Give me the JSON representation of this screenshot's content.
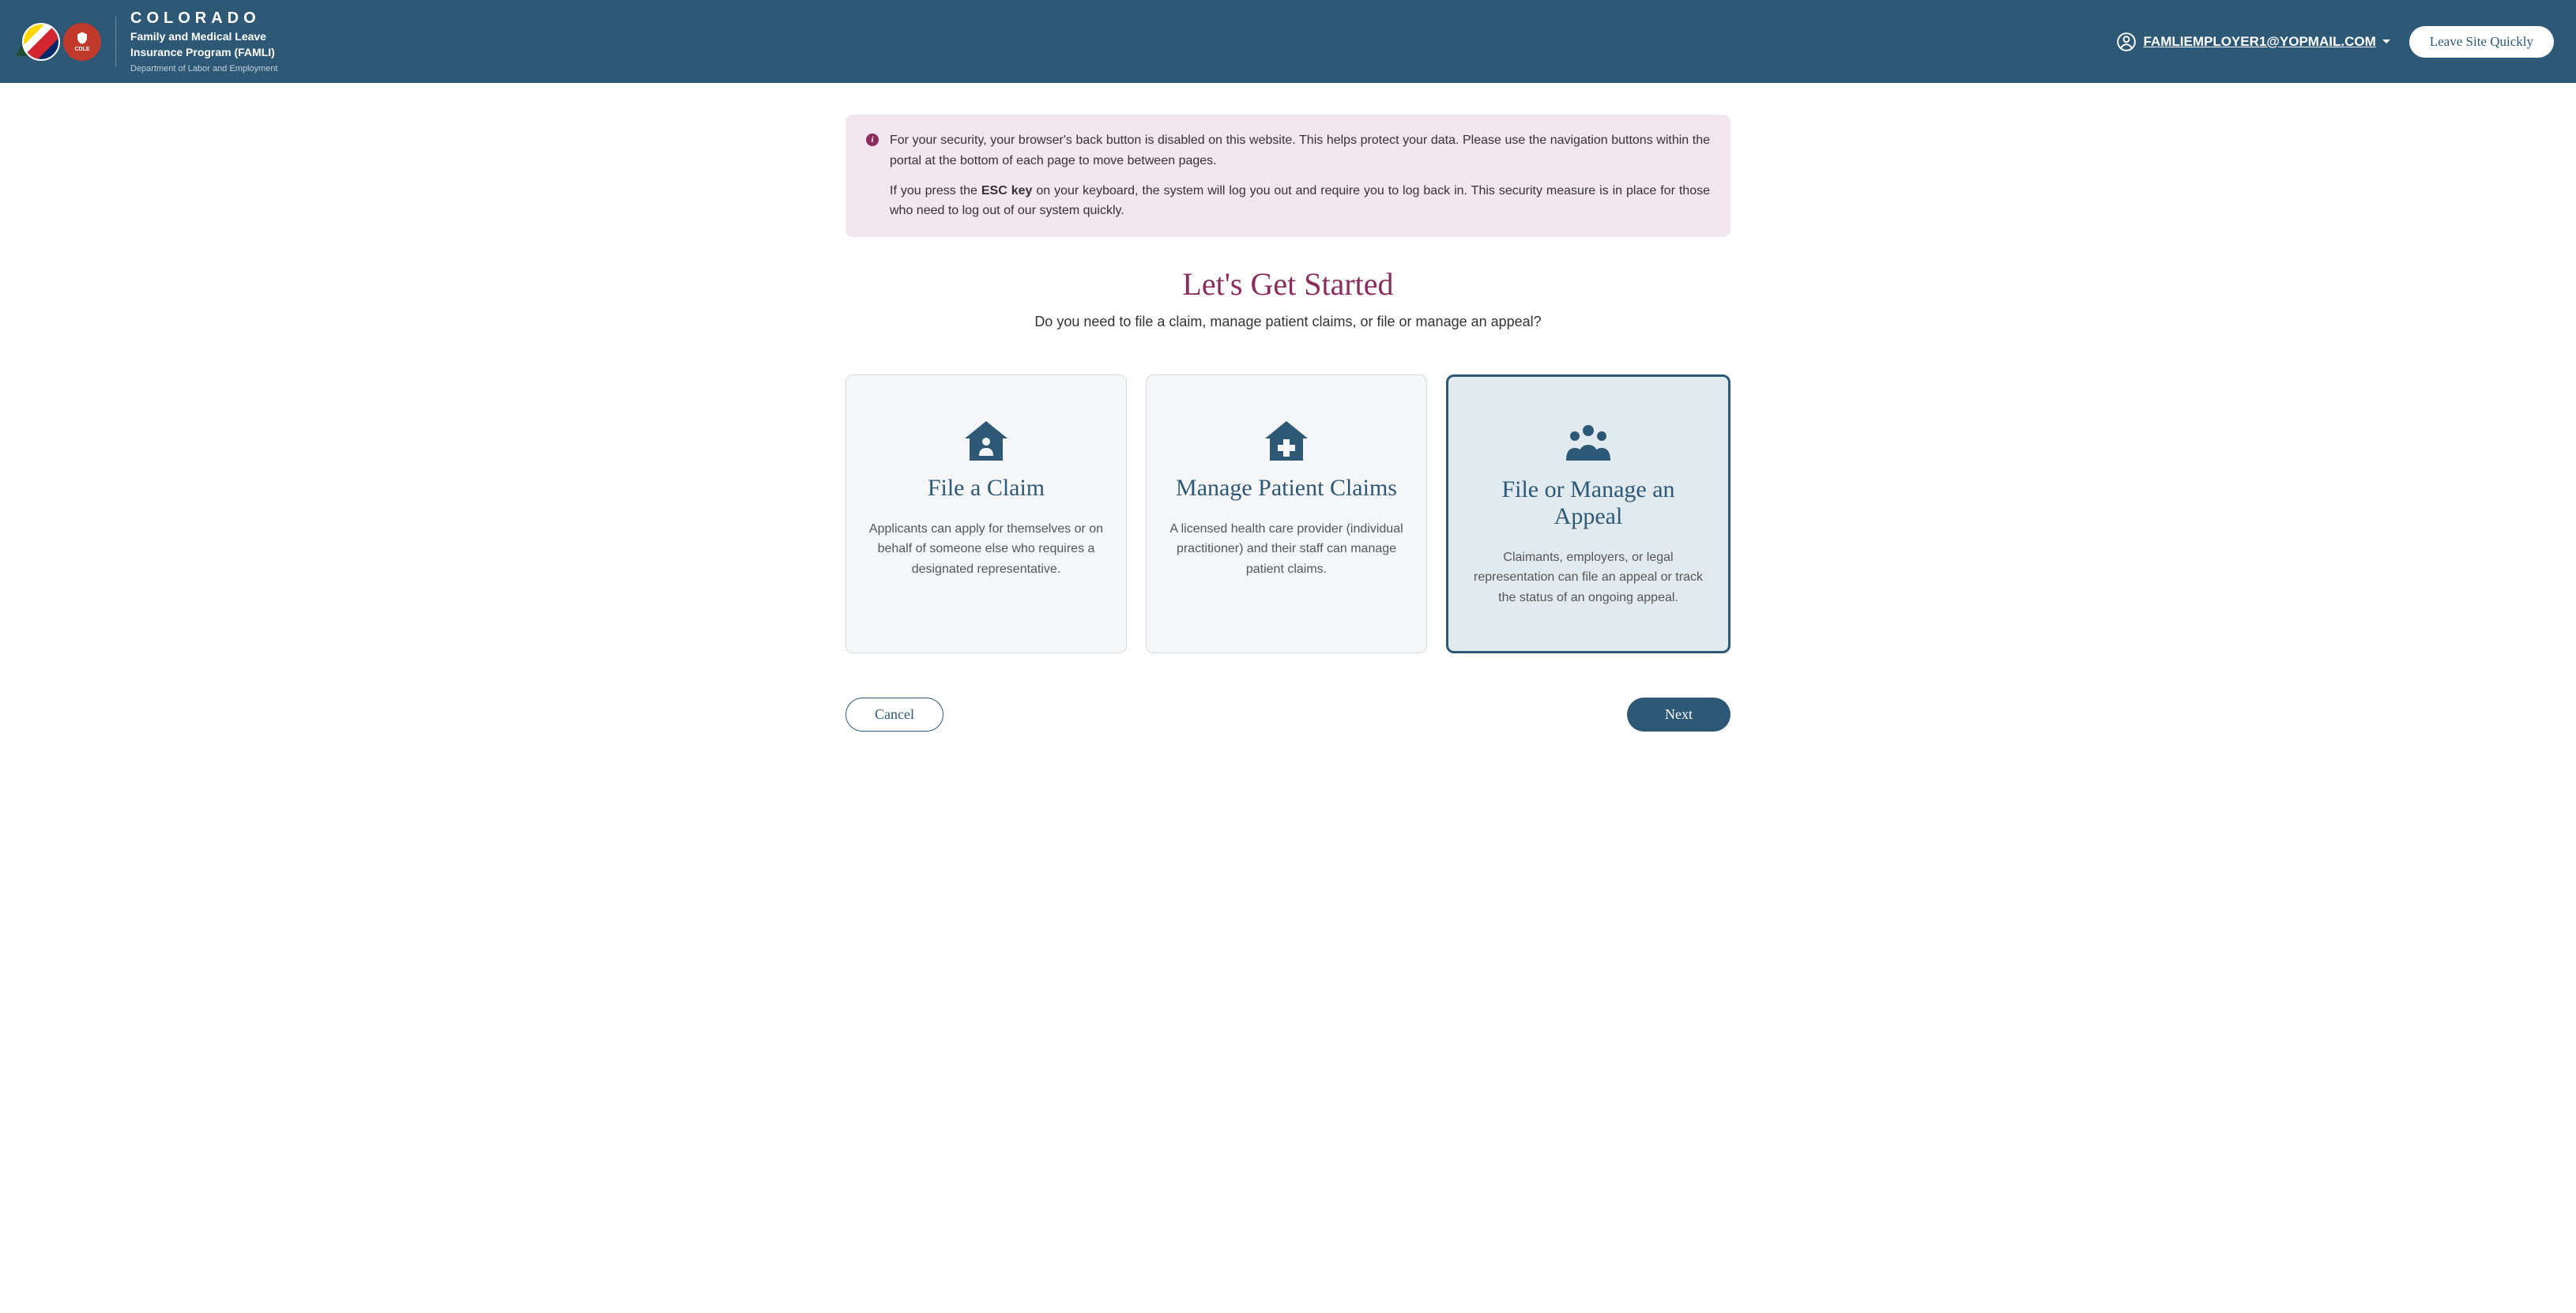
{
  "header": {
    "title_main": "COLORADO",
    "title_sub_line1": "Family and Medical Leave",
    "title_sub_line2": "Insurance Program (FAMLI)",
    "title_dept": "Department of Labor and Employment",
    "logo_cdle_text": "CDLE",
    "user_email": "FAMLIEMPLOYER1@YOPMAIL.COM",
    "leave_quickly_label": "Leave Site Quickly"
  },
  "banner": {
    "para1_pre": "For your security, your browser's back button is disabled on this website. This helps protect your data. Please use the navigation buttons within the portal at the bottom of each page to move between pages.",
    "para2_pre": "If you press the ",
    "para2_key": "ESC key",
    "para2_post": " on your keyboard, the system will log you out and require you to log back in. This security measure is in place for those who need to log out of our system quickly."
  },
  "page": {
    "title": "Let's Get Started",
    "subtitle": "Do you need to file a claim, manage patient claims, or file or manage an appeal?"
  },
  "cards": {
    "file_claim": {
      "title": "File a Claim",
      "desc": "Applicants can apply for themselves or on behalf of someone else who requires a designated representative."
    },
    "manage_patient": {
      "title": "Manage Patient Claims",
      "desc": "A licensed health care provider (individual practitioner) and their staff can manage patient claims."
    },
    "manage_appeal": {
      "title": "File or Manage an Appeal",
      "desc": "Claimants, employers, or legal representation can file an appeal or track the status of an ongoing appeal."
    }
  },
  "footer": {
    "cancel_label": "Cancel",
    "next_label": "Next"
  },
  "selected_card": "manage_appeal"
}
